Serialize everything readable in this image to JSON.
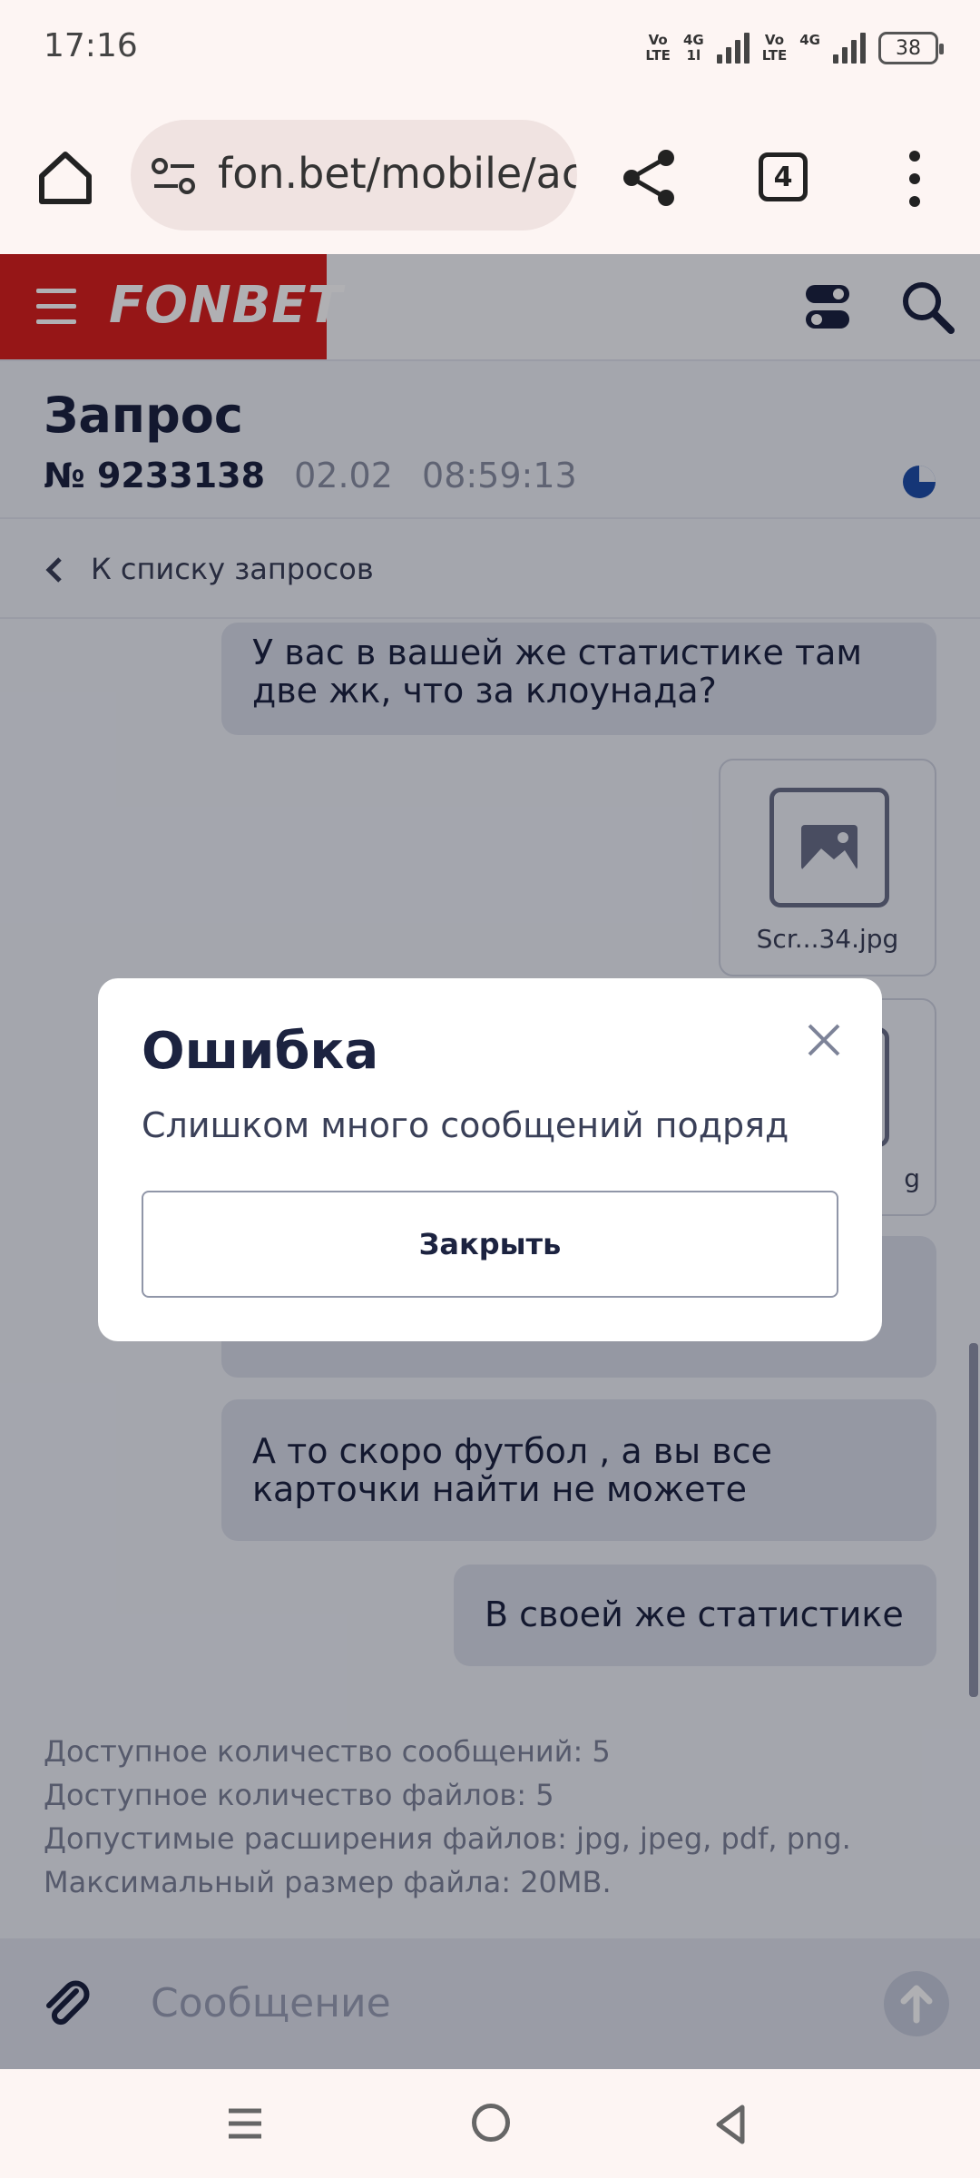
{
  "status_bar": {
    "time": "17:16",
    "net1_top": "Vo",
    "net1_bottom": "LTE",
    "net2_top": "4G",
    "net2_bottom": "1l",
    "net3_top": "Vo",
    "net3_bottom": "LTE",
    "net4_top": "4G",
    "battery": "38"
  },
  "browser": {
    "url": "fon.bet/mobile/account/requests",
    "tab_count": "4",
    "icons": [
      "home-icon",
      "site-settings-icon",
      "share-icon",
      "tabs-icon",
      "more-vert-icon"
    ]
  },
  "app_header": {
    "logo": "FONBET",
    "brand_color": "#d9201d",
    "icons": [
      "menu-icon",
      "toggle-icon",
      "search-icon"
    ]
  },
  "request": {
    "title": "Запрос",
    "number": "№ 9233138",
    "date": "02.02",
    "time": "08:59:13",
    "status_icon": "pie-status-icon",
    "status_color": "#1f4fa8"
  },
  "back_link": {
    "label": "К списку запросов"
  },
  "messages": [
    {
      "text": "У вас в вашей же статистике там две жк, что за клоунада?"
    },
    {
      "file": "Scr...34.jpg"
    },
    {
      "file_suffix": "g"
    },
    {
      "text": "А то скоро футбол , а вы все карточки найти не можете"
    },
    {
      "text": "В своей же статистике"
    }
  ],
  "limits": [
    "Доступное количество сообщений: 5",
    "Доступное количество файлов: 5",
    "Допустимые расширения файлов: jpg, jpeg, pdf, png.",
    "Максимальный размер файла: 20MB."
  ],
  "composer": {
    "placeholder": "Сообщение"
  },
  "modal": {
    "title": "Ошибка",
    "text": "Слишком много сообщений подряд",
    "button": "Закрыть"
  }
}
